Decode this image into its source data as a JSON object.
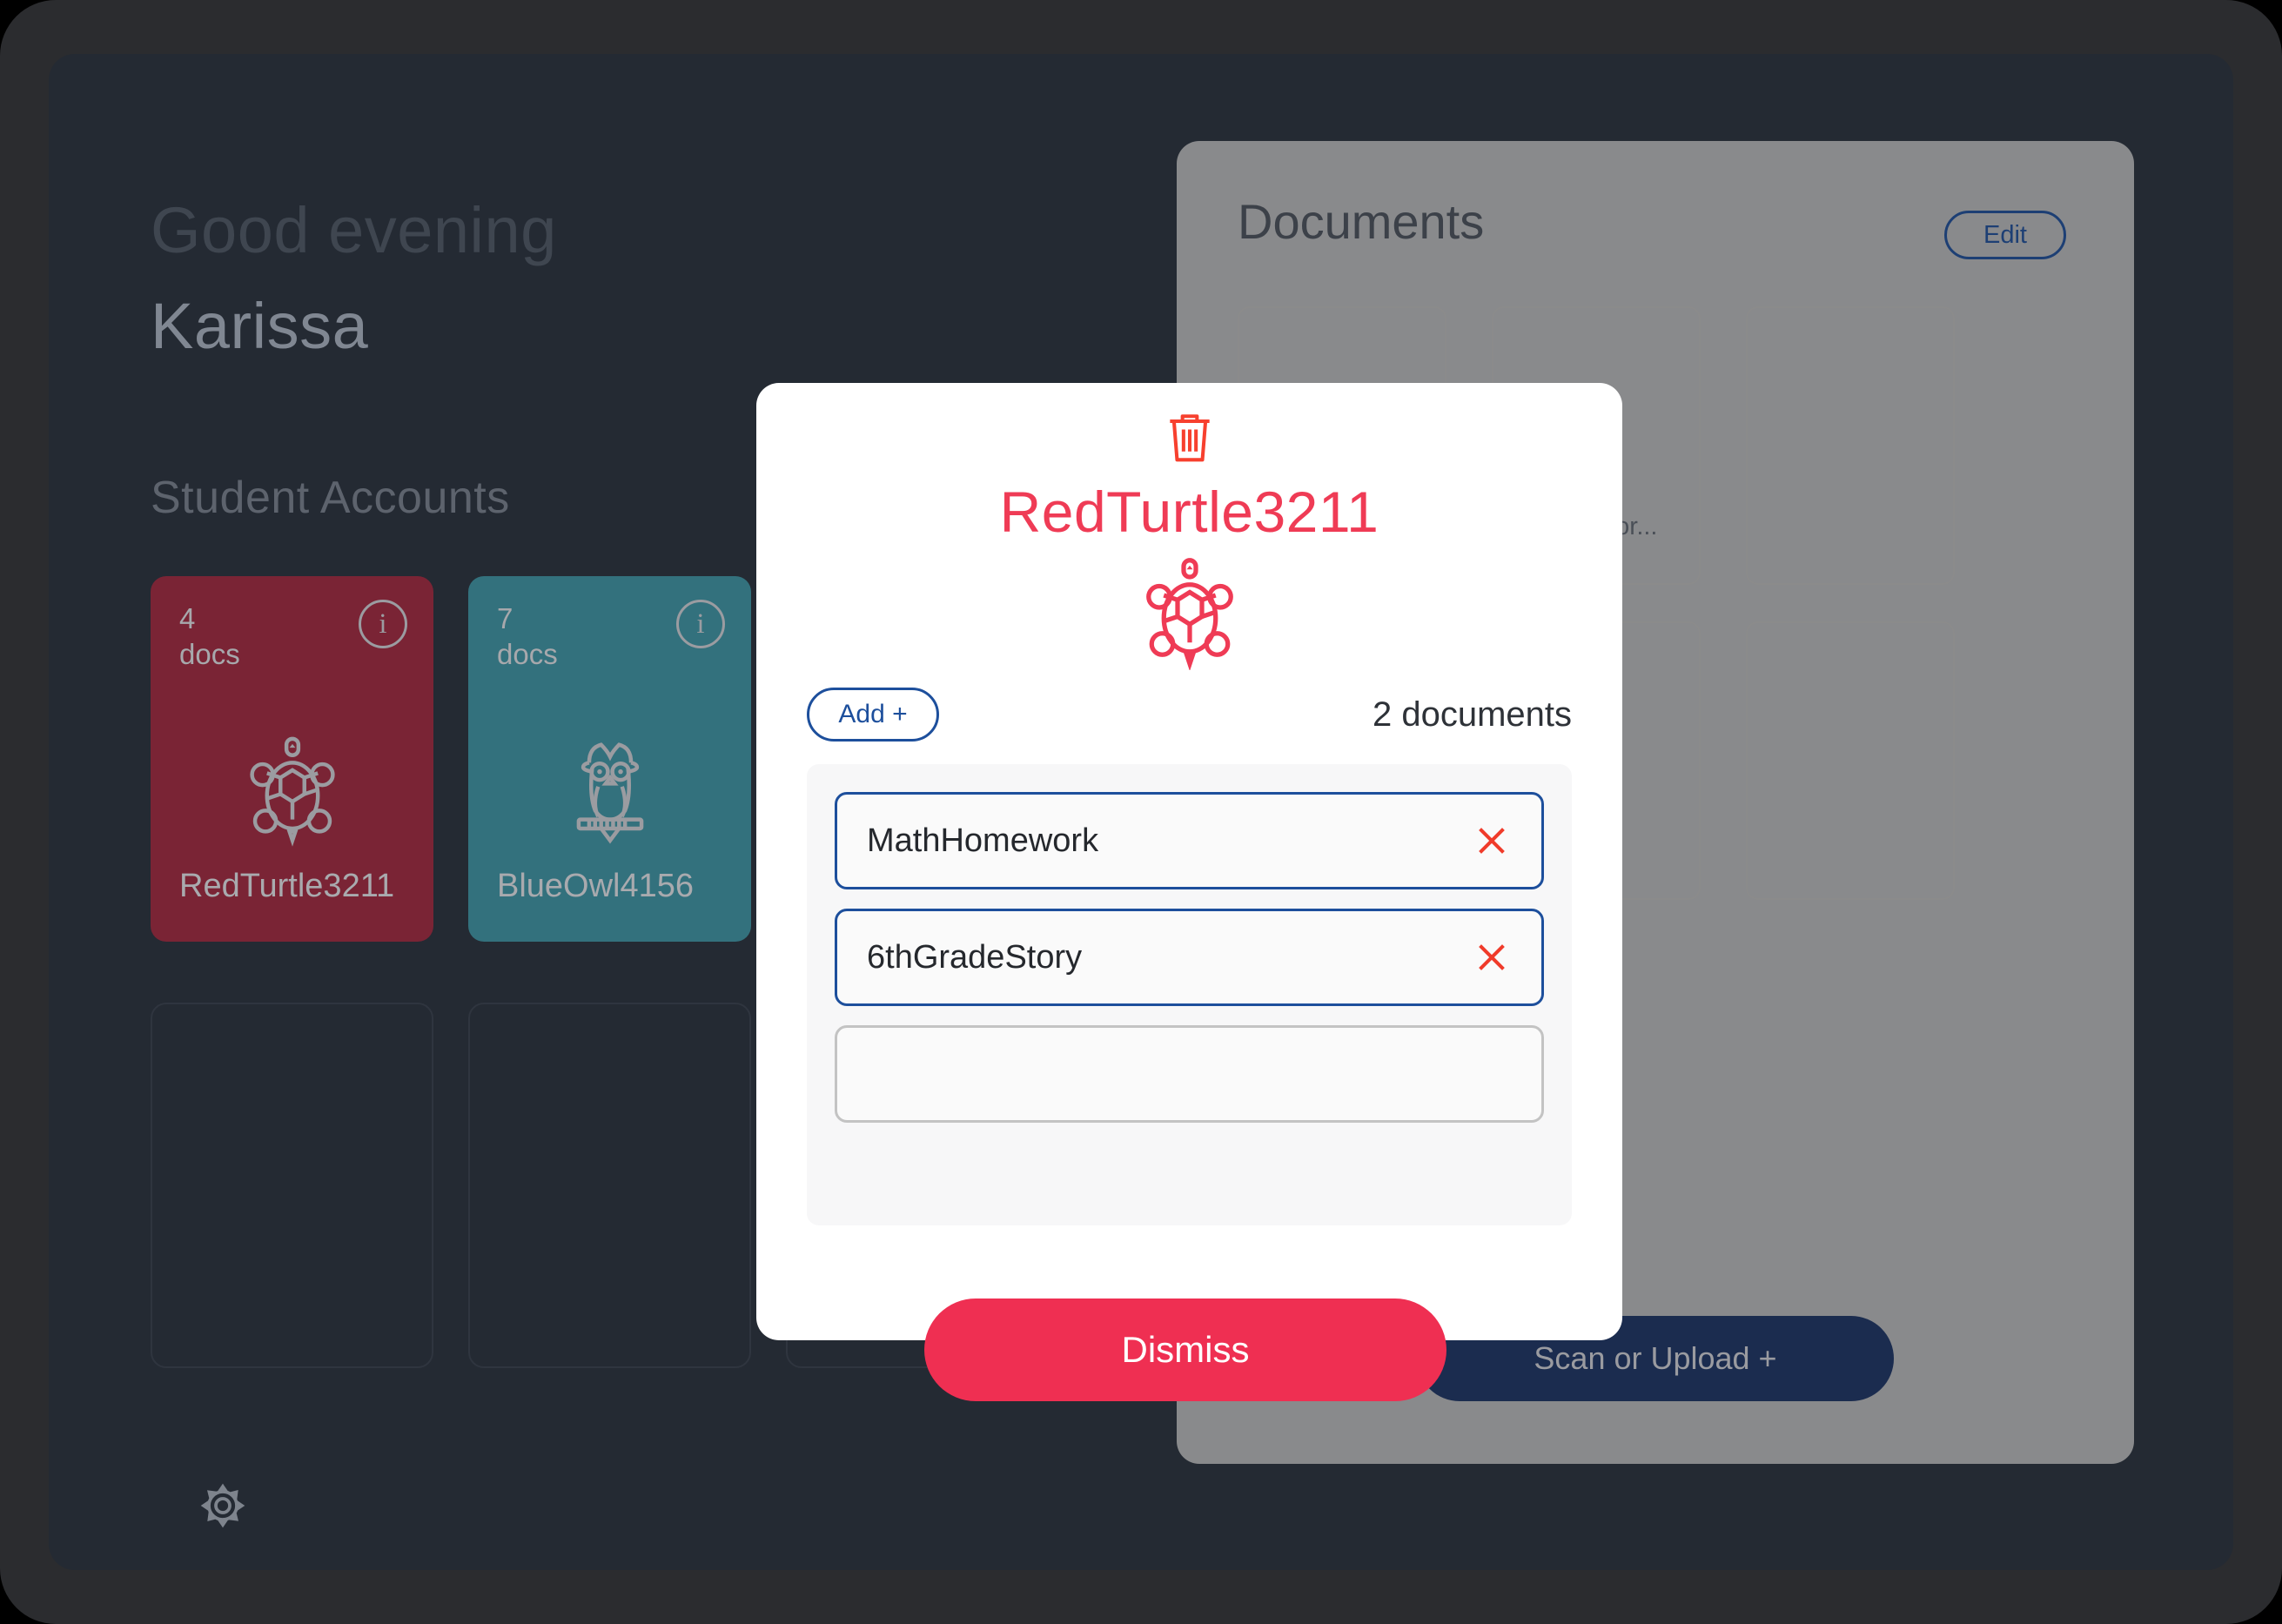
{
  "home": {
    "greeting": "Good evening",
    "user_name": "Karissa",
    "section_title": "Student Accounts",
    "settings_icon": "gear-icon",
    "student_cards": [
      {
        "docs_count": "4\ndocs",
        "label": "RedTurtle3211",
        "animal_icon": "turtle-icon",
        "color": "#7a2435",
        "info_icon": "info-icon"
      },
      {
        "docs_count": "7\ndocs",
        "label": "BlueOwl4156",
        "animal_icon": "owl-icon",
        "color": "#33717d",
        "info_icon": "info-icon"
      }
    ],
    "empty_slots": 3
  },
  "documents_panel": {
    "title": "Documents",
    "edit_label": "Edit",
    "scan_upload_label": "Scan or Upload +",
    "tiles": [
      {
        "label": ""
      },
      {
        "label": "hGradeStor..."
      },
      {
        "label": ""
      },
      {
        "label": ""
      },
      {
        "label": ""
      },
      {
        "label": ""
      }
    ]
  },
  "modal": {
    "trash_icon": "trash-icon",
    "title": "RedTurtle3211",
    "animal_icon": "turtle-icon",
    "add_label": "Add +",
    "document_count_label": "2 documents",
    "documents": [
      {
        "name": "MathHomework",
        "remove_icon": "close-icon"
      },
      {
        "name": "6thGradeStory",
        "remove_icon": "close-icon"
      },
      {
        "name": "",
        "remove_icon": ""
      }
    ],
    "dismiss_label": "Dismiss"
  },
  "colors": {
    "accent_red": "#ef3b55",
    "accent_blue": "#1d4f9c",
    "navy": "#1b2c4f",
    "screen_bg": "#242a33"
  }
}
